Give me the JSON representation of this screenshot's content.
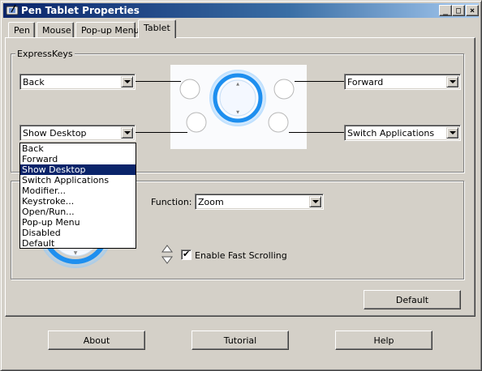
{
  "window": {
    "title": "Pen Tablet Properties",
    "controls": {
      "minimize": "_",
      "maximize": "□",
      "close": "×"
    }
  },
  "tabs": [
    {
      "label": "Pen",
      "active": false
    },
    {
      "label": "Mouse",
      "active": false
    },
    {
      "label": "Pop-up Menu",
      "active": false
    },
    {
      "label": "Tablet",
      "active": true
    }
  ],
  "expresskeys": {
    "group_label": "ExpressKeys",
    "top_left": "Back",
    "top_right": "Forward",
    "bottom_left": "Show Desktop",
    "bottom_right": "Switch Applications"
  },
  "dropdown": {
    "items": [
      "Back",
      "Forward",
      "Show Desktop",
      "Switch Applications",
      "Modifier...",
      "Keystroke...",
      "Open/Run...",
      "Pop-up Menu",
      "Disabled",
      "Default"
    ],
    "selected": "Show Desktop"
  },
  "touch_ring": {
    "function_label": "Function:",
    "function_value": "Zoom",
    "fast_scrolling_label": "Enable Fast Scrolling",
    "fast_scrolling_checked": true
  },
  "buttons": {
    "default": "Default",
    "about": "About",
    "tutorial": "Tutorial",
    "help": "Help"
  },
  "colors": {
    "title_bar_start": "#0a246a",
    "title_bar_end": "#a6caf0",
    "ring_blue": "#1e8fef",
    "selection": "#0a246a"
  }
}
